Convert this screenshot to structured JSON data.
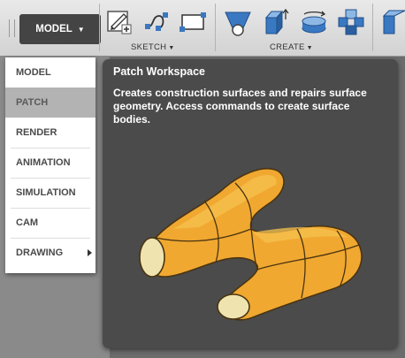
{
  "toolbar": {
    "workspace_button": "MODEL",
    "groups": [
      {
        "label": "SKETCH",
        "tools": [
          "sketch-create-icon",
          "spline-icon",
          "rectangle-icon"
        ]
      },
      {
        "label": "CREATE",
        "tools": [
          "loft-icon",
          "box-icon",
          "revolve-icon",
          "move-icon"
        ]
      }
    ]
  },
  "workspace_menu": {
    "items": [
      {
        "label": "MODEL"
      },
      {
        "label": "PATCH",
        "active": true
      },
      {
        "label": "RENDER"
      },
      {
        "label": "ANIMATION"
      },
      {
        "label": "SIMULATION"
      },
      {
        "label": "CAM"
      },
      {
        "label": "DRAWING",
        "submenu": true
      }
    ]
  },
  "tooltip": {
    "title": "Patch Workspace",
    "description": "Creates construction surfaces and repairs surface geometry. Access commands to create surface bodies.",
    "illustration": "orange-surface-body"
  },
  "colors": {
    "toolbar_bg": "#dedede",
    "workspace_button_bg": "#444444",
    "menu_active_bg": "#b3b3b3",
    "tooltip_bg": "#4b4b4b",
    "surface_orange": "#f0a830",
    "icon_blue": "#3a78c2"
  }
}
